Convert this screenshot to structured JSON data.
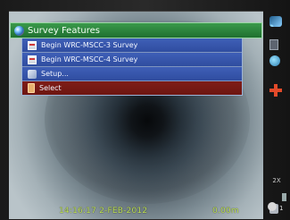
{
  "menu": {
    "title": "Survey Features",
    "items": [
      {
        "label": "Begin WRC-MSCC-3 Survey",
        "icon": "survey-document-icon",
        "style": "blue"
      },
      {
        "label": "Begin WRC-MSCC-4 Survey",
        "icon": "survey-document-icon",
        "style": "blue"
      },
      {
        "label": "Setup...",
        "icon": "setup-tools-icon",
        "style": "blue"
      },
      {
        "label": "Select",
        "icon": "select-icon",
        "style": "red"
      }
    ]
  },
  "overlay": {
    "timestamp": "14:16:17 2-FEB-2012",
    "distance": "0.00m"
  },
  "side": {
    "zoom_label": "2X",
    "bottom_count": "1"
  },
  "colors": {
    "menu_title": "#2f8b3f",
    "menu_item": "#3754a9",
    "menu_selected": "#7a1b16",
    "osd_text": "#c2e55a"
  }
}
